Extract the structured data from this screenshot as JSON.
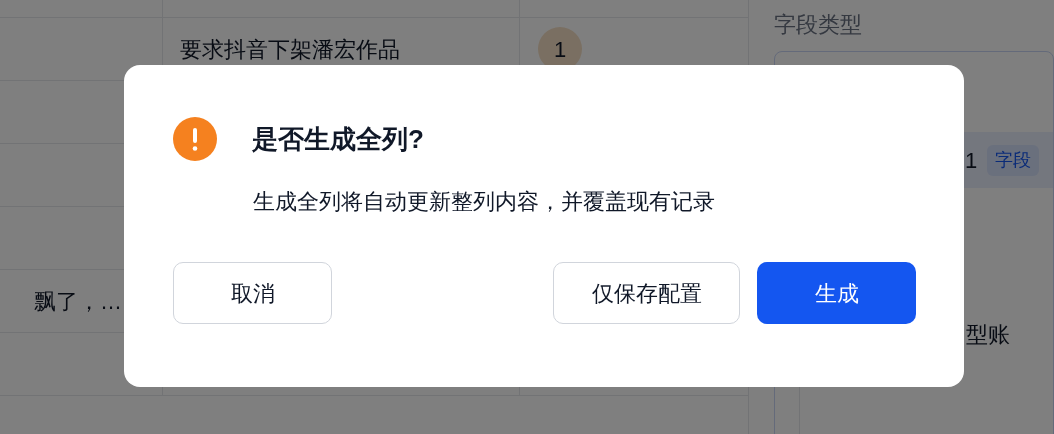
{
  "table": {
    "rows": [
      {
        "title": "要求抖音下架潘宏作品",
        "count": "1"
      },
      {
        "description": "飘了，…"
      }
    ]
  },
  "side_panel": {
    "label": "字段类型",
    "selected_item": {
      "number": "1",
      "tag": "字段"
    },
    "item_2": "型账"
  },
  "dialog": {
    "title": "是否生成全列?",
    "message": "生成全列将自动更新整列内容，并覆盖现有记录",
    "buttons": [
      {
        "label": "取消",
        "kind": "secondary"
      },
      {
        "label": "仅保存配置",
        "kind": "secondary"
      },
      {
        "label": "生成",
        "kind": "primary"
      }
    ]
  }
}
